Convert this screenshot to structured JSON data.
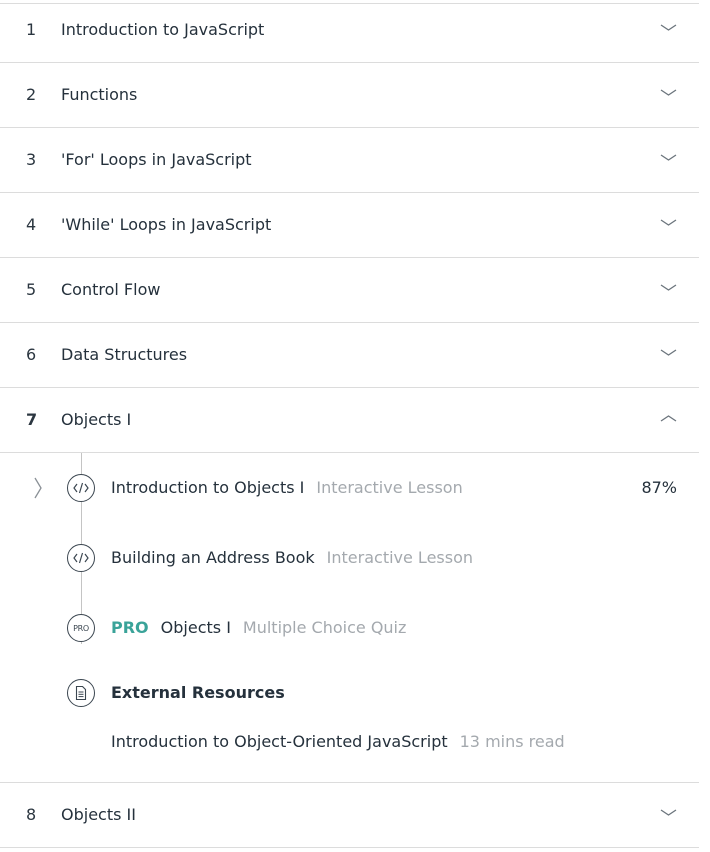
{
  "units_before": [
    {
      "number": "1",
      "title": "Introduction to JavaScript"
    },
    {
      "number": "2",
      "title": "Functions"
    },
    {
      "number": "3",
      "title": "'For' Loops in JavaScript"
    },
    {
      "number": "4",
      "title": "'While' Loops in JavaScript"
    },
    {
      "number": "5",
      "title": "Control Flow"
    },
    {
      "number": "6",
      "title": "Data Structures"
    }
  ],
  "open_unit": {
    "number": "7",
    "title": "Objects I",
    "lessons": [
      {
        "title": "Introduction to Objects I",
        "kind": "Interactive Lesson",
        "progress": "87%",
        "icon": "code-icon"
      },
      {
        "title": "Building an Address Book",
        "kind": "Interactive Lesson",
        "icon": "code-icon"
      },
      {
        "badge": "PRO",
        "title": "Objects I",
        "kind": "Multiple Choice Quiz",
        "icon": "pro-icon",
        "icon_text": "PRO"
      }
    ],
    "external": {
      "heading": "External Resources",
      "icon": "document-icon",
      "items": [
        {
          "title": "Introduction to Object-Oriented JavaScript",
          "meta": "13 mins read"
        }
      ]
    }
  },
  "units_after": [
    {
      "number": "8",
      "title": "Objects II"
    }
  ],
  "colors": {
    "text": "#25313c",
    "muted": "#a4a9ae",
    "pro": "#3aa399",
    "rule": "#dcdcdc"
  }
}
